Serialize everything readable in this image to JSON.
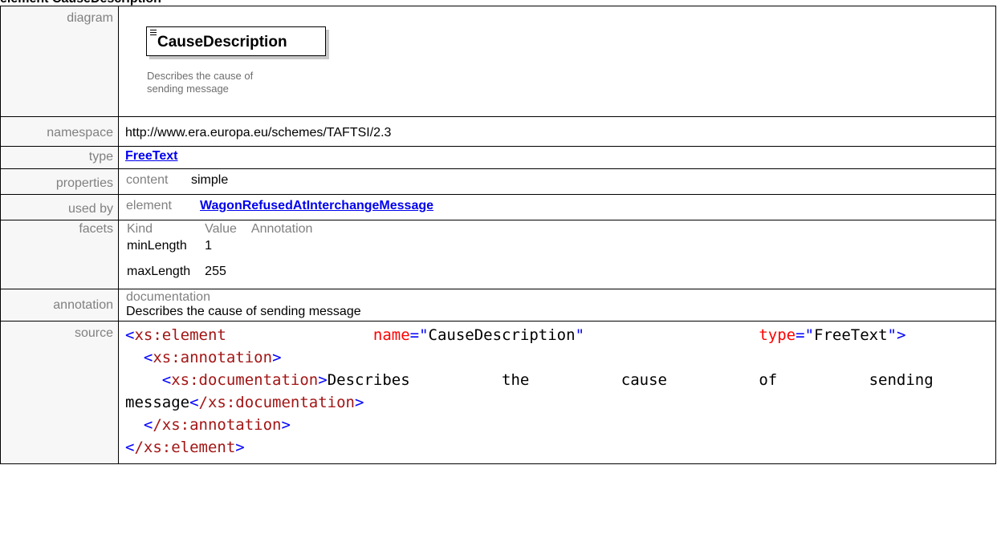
{
  "heading": "element CauseDescription",
  "rows": {
    "diagram": {
      "label": "diagram",
      "element_name": "CauseDescription",
      "annotation": "Describes the cause of sending message"
    },
    "namespace": {
      "label": "namespace",
      "value": "http://www.era.europa.eu/schemes/TAFTSI/2.3"
    },
    "type": {
      "label": "type",
      "value": "FreeText"
    },
    "properties": {
      "label": "properties",
      "key": "content",
      "value": "simple"
    },
    "used_by": {
      "label": "used by",
      "key": "element",
      "value": "WagonRefusedAtInterchangeMessage"
    },
    "facets": {
      "label": "facets",
      "headers": [
        "Kind",
        "Value",
        "Annotation"
      ],
      "rows": [
        {
          "kind": "minLength",
          "value": "1",
          "annotation": ""
        },
        {
          "kind": "maxLength",
          "value": "255",
          "annotation": ""
        }
      ]
    },
    "annotation": {
      "label": "annotation",
      "key": "documentation",
      "value": "Describes the cause of sending message"
    },
    "source": {
      "label": "source",
      "element_open": "xs:element",
      "attr_name": "name",
      "attr_name_value": "CauseDescription",
      "attr_type": "type",
      "attr_type_value": "FreeText",
      "annotation_tag": "xs:annotation",
      "documentation_tag": "xs:documentation",
      "documentation_text_1": "Describes          the          cause          of          sending",
      "documentation_text_2": "message",
      "documentation_close": "/xs:documentation",
      "annotation_close": "/xs:annotation",
      "element_close": "/xs:element"
    }
  }
}
